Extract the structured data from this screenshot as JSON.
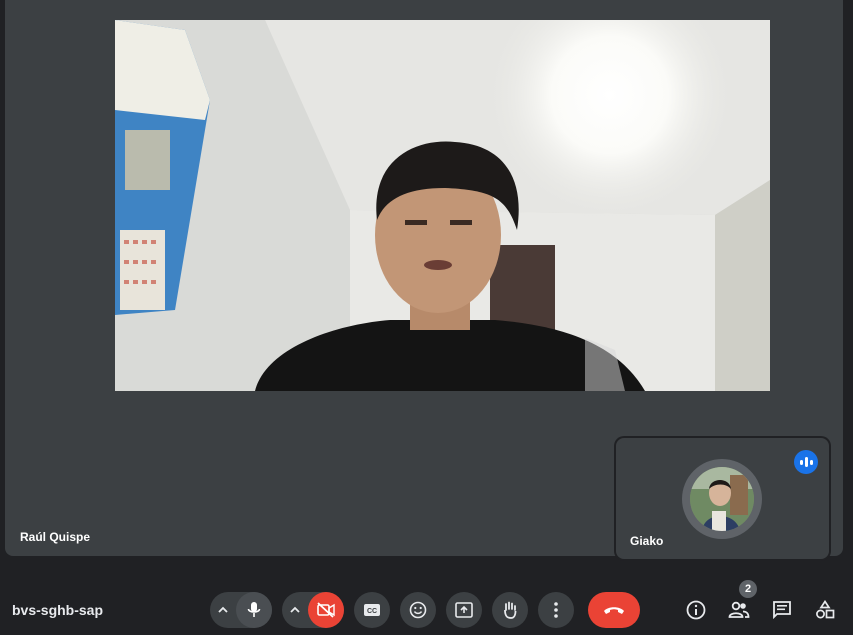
{
  "meeting": {
    "code": "bvs-sghb-sap"
  },
  "main_participant": {
    "name": "Raúl Quispe"
  },
  "self_participant": {
    "name": "Giako",
    "speaking": true
  },
  "participants_count": "2",
  "controls": [
    "mic-options",
    "microphone",
    "camera-options",
    "camera-off",
    "captions",
    "reactions",
    "present-screen",
    "raise-hand",
    "more-options",
    "leave-call"
  ],
  "right_panel": [
    "meeting-details",
    "people",
    "chat",
    "activities"
  ],
  "colors": {
    "background": "#202124",
    "tile": "#3c4043",
    "danger": "#ea4335",
    "accent": "#1a73e8"
  }
}
